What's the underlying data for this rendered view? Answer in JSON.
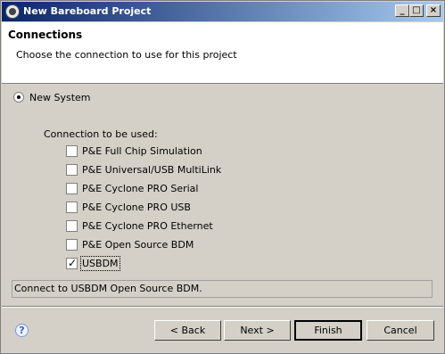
{
  "window": {
    "title": "New Bareboard Project",
    "controls": {
      "minimize": "_",
      "maximize": "□",
      "close": "×"
    }
  },
  "header": {
    "title": "Connections",
    "description": "Choose the connection to use for this project"
  },
  "system_option": {
    "label": "New System",
    "selected": true
  },
  "connections": {
    "heading": "Connection to be used:",
    "items": [
      {
        "label": "P&E Full Chip Simulation",
        "checked": false
      },
      {
        "label": "P&E Universal/USB MultiLink",
        "checked": false
      },
      {
        "label": "P&E Cyclone PRO Serial",
        "checked": false
      },
      {
        "label": "P&E Cyclone PRO USB",
        "checked": false
      },
      {
        "label": "P&E Cyclone PRO Ethernet",
        "checked": false
      },
      {
        "label": "P&E Open Source BDM",
        "checked": false
      },
      {
        "label": "USBDM",
        "checked": true
      }
    ]
  },
  "connection_description": "Connect to USBDM Open Source BDM.",
  "buttons": {
    "help": "?",
    "back": "< Back",
    "next": "Next >",
    "finish": "Finish",
    "cancel": "Cancel"
  }
}
